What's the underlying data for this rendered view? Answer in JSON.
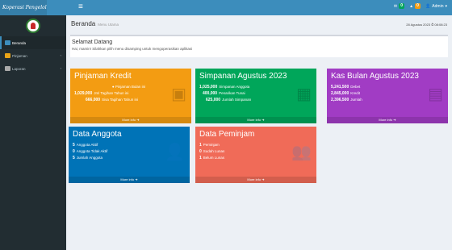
{
  "brand": {
    "name": "Koperasi Pengelolaan Modal"
  },
  "topbar": {
    "toggle_icon": "≡",
    "badges": [
      {
        "icon": "envelope-icon",
        "count": "0",
        "color": "#00a65a"
      },
      {
        "icon": "bell-icon",
        "count": "0",
        "color": "#f39c12"
      }
    ],
    "user_label": "Admin"
  },
  "sidebar": {
    "items": [
      {
        "label": "Beranda",
        "icon": "home-icon",
        "color": "#3c8dbc",
        "active": true
      },
      {
        "label": "Pinjaman",
        "icon": "bank-icon",
        "color": "#e8a317",
        "active": false
      },
      {
        "label": "Laporan",
        "icon": "report-icon",
        "color": "#aaaaaa",
        "active": false
      }
    ]
  },
  "header": {
    "title": "Beranda",
    "subtitle": "Menu Utama",
    "date": "28 Agustus 2023 ⏱ 08:08:23"
  },
  "welcome": {
    "heading": "Selamat Datang",
    "text": "Hai, mamin! Silahkan pilih menu disamping untuk mengoperasikan aplikasi"
  },
  "boxes": {
    "pinjaman": {
      "title": "Pinjaman Kredit",
      "rows": [
        {
          "value": "",
          "label": "Pinjaman Bulan ini",
          "centered": true
        },
        {
          "value": "1,029,000",
          "label": "Jml Tagihan Tahun ini"
        },
        {
          "value": "666,000",
          "label": "Sisa Tagihan Tahun ini"
        }
      ],
      "footer": "More info ➔",
      "color": "#f39c12"
    },
    "simpanan": {
      "title": "Simpanan Agustus 2023",
      "rows": [
        {
          "value": "1,025,000",
          "label": "Simpanan Anggota"
        },
        {
          "value": "400,000",
          "label": "Penarikan Tunai"
        },
        {
          "value": "625,000",
          "label": "Jumlah Simpanan"
        }
      ],
      "footer": "More info ➔",
      "color": "#00a65a"
    },
    "kas": {
      "title": "Kas Bulan Agustus 2023",
      "rows": [
        {
          "value": "5,241,500",
          "label": "Debet"
        },
        {
          "value": "2,845,000",
          "label": "Kredit"
        },
        {
          "value": "2,396,500",
          "label": "Jumlah"
        }
      ],
      "footer": "More info ➔",
      "color": "#a13cc4"
    },
    "anggota": {
      "title": "Data Anggota",
      "rows": [
        {
          "value": "5",
          "label": "Anggota Aktif"
        },
        {
          "value": "0",
          "label": "Anggota Tidak Aktif"
        },
        {
          "value": "5",
          "label": "Jumlah Anggota"
        }
      ],
      "footer": "More info ➔",
      "color": "#0073b7"
    },
    "peminjam": {
      "title": "Data Peminjam",
      "rows": [
        {
          "value": "1",
          "label": "Peminjam"
        },
        {
          "value": "0",
          "label": "Sudah Lunas"
        },
        {
          "value": "1",
          "label": "Belum Lunas"
        }
      ],
      "footer": "More info ➔",
      "color": "#f06b58"
    }
  }
}
